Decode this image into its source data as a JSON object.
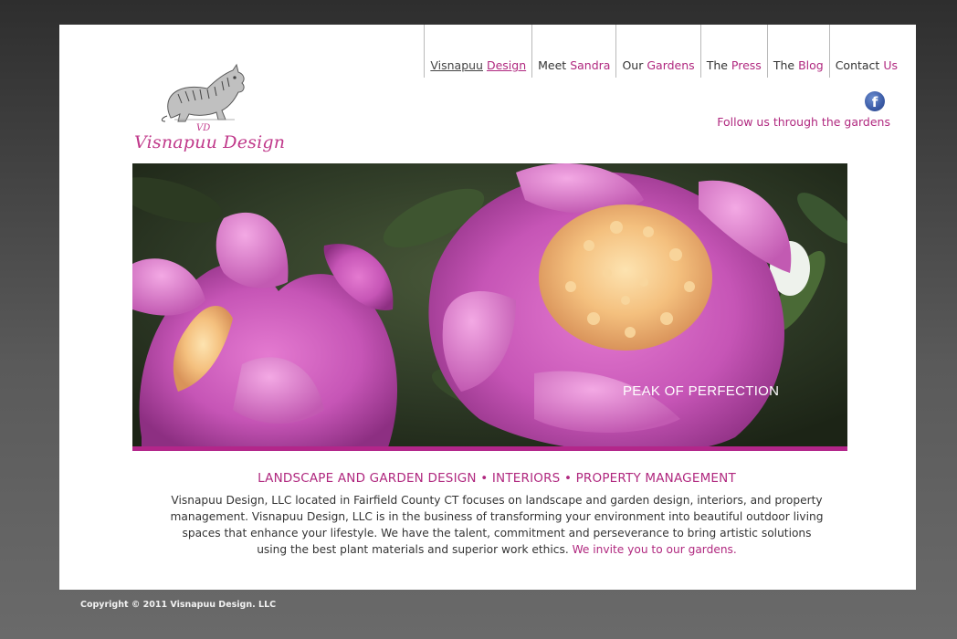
{
  "nav": {
    "items": [
      {
        "w1": "Visnapuu",
        "w2": "Design"
      },
      {
        "w1": "Meet",
        "w2": "Sandra"
      },
      {
        "w1": "Our",
        "w2": "Gardens"
      },
      {
        "w1": "The",
        "w2": "Press"
      },
      {
        "w1": "The",
        "w2": "Blog"
      },
      {
        "w1": "Contact",
        "w2": "Us"
      }
    ]
  },
  "logo": {
    "monogram": "VD",
    "name": "Visnapuu Design"
  },
  "social": {
    "facebook_icon": "f",
    "follow_text": "Follow us through the gardens"
  },
  "hero": {
    "caption": "PEAK OF PERFECTION"
  },
  "content": {
    "tagline": "LANDSCAPE AND GARDEN DESIGN • INTERIORS • PROPERTY MANAGEMENT",
    "body": "Visnapuu Design, LLC located in Fairfield County CT focuses on landscape and garden design, interiors, and property management. Visnapuu Design, LLC is in the business of transforming your environment into beautiful outdoor living spaces that enhance your lifestyle. We have the talent, commitment and perseverance to bring artistic solutions using the best plant materials and superior work ethics.",
    "invite_link": "We invite you to our gardens."
  },
  "footer": {
    "copyright": "Copyright © 2011 Visnapuu Design. LLC"
  },
  "colors": {
    "accent": "#b0287f",
    "hero_bar": "#b3268a",
    "page_bg": "#ffffff"
  }
}
